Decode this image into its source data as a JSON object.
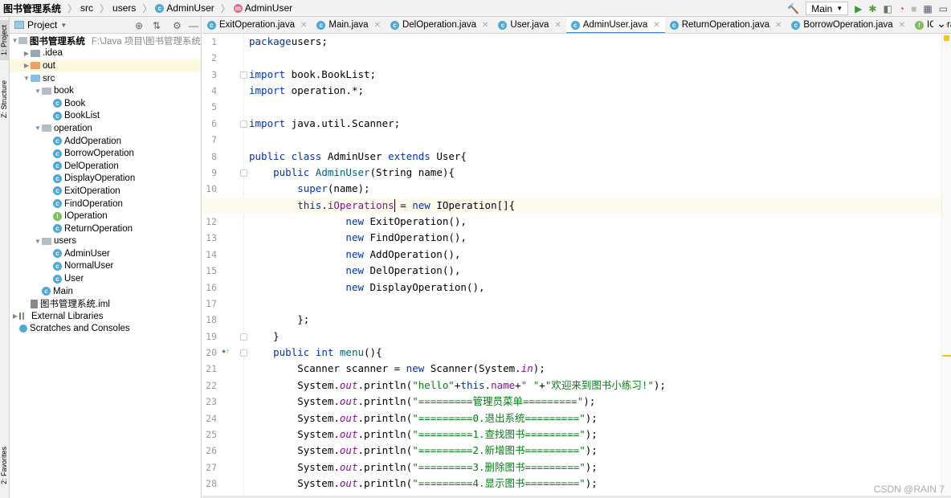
{
  "breadcrumb": [
    {
      "label": "图书管理系统",
      "icon": ""
    },
    {
      "label": "src",
      "icon": ""
    },
    {
      "label": "users",
      "icon": ""
    },
    {
      "label": "AdminUser",
      "icon": "class"
    },
    {
      "label": "AdminUser",
      "icon": "method"
    }
  ],
  "toolbar": {
    "run_config": "Main",
    "icons": [
      "hammer-icon",
      "run-icon",
      "debug-icon",
      "coverage-icon",
      "profile-icon",
      "stop-icon",
      "project-structure-icon",
      "terminal-icon"
    ]
  },
  "left_strip": {
    "project": "1: Project",
    "structure": "Z: Structure",
    "favorites": "2: Favorites"
  },
  "project_panel": {
    "title": "Project"
  },
  "tree": [
    {
      "label": "图书管理系统",
      "path": "F:\\Java  项目\\图书管理系统",
      "depth": 0,
      "arrow": "▼",
      "icon": "module",
      "bold": true
    },
    {
      "label": ".idea",
      "depth": 1,
      "arrow": "▶",
      "icon": "folder"
    },
    {
      "label": "out",
      "depth": 1,
      "arrow": "▶",
      "icon": "folder-orange",
      "selected": true
    },
    {
      "label": "src",
      "depth": 1,
      "arrow": "▼",
      "icon": "folder-blue"
    },
    {
      "label": "book",
      "depth": 2,
      "arrow": "▼",
      "icon": "package"
    },
    {
      "label": "Book",
      "depth": 3,
      "icon": "class"
    },
    {
      "label": "BookList",
      "depth": 3,
      "icon": "class"
    },
    {
      "label": "operation",
      "depth": 2,
      "arrow": "▼",
      "icon": "package"
    },
    {
      "label": "AddOperation",
      "depth": 3,
      "icon": "class"
    },
    {
      "label": "BorrowOperation",
      "depth": 3,
      "icon": "class"
    },
    {
      "label": "DelOperation",
      "depth": 3,
      "icon": "class"
    },
    {
      "label": "DisplayOperation",
      "depth": 3,
      "icon": "class"
    },
    {
      "label": "ExitOperation",
      "depth": 3,
      "icon": "class"
    },
    {
      "label": "FindOperation",
      "depth": 3,
      "icon": "class"
    },
    {
      "label": "IOperation",
      "depth": 3,
      "icon": "interface"
    },
    {
      "label": "ReturnOperation",
      "depth": 3,
      "icon": "class"
    },
    {
      "label": "users",
      "depth": 2,
      "arrow": "▼",
      "icon": "package"
    },
    {
      "label": "AdminUser",
      "depth": 3,
      "icon": "class"
    },
    {
      "label": "NormalUser",
      "depth": 3,
      "icon": "class"
    },
    {
      "label": "User",
      "depth": 3,
      "icon": "class"
    },
    {
      "label": "Main",
      "depth": 2,
      "icon": "class"
    },
    {
      "label": "图书管理系统.iml",
      "depth": 1,
      "icon": "file"
    },
    {
      "label": "External Libraries",
      "depth": 0,
      "arrow": "▶",
      "icon": "library"
    },
    {
      "label": "Scratches and Consoles",
      "depth": 0,
      "icon": "scratch"
    }
  ],
  "tabs": [
    {
      "label": "ExitOperation.java",
      "icon": "class"
    },
    {
      "label": "Main.java",
      "icon": "class"
    },
    {
      "label": "DelOperation.java",
      "icon": "class"
    },
    {
      "label": "User.java",
      "icon": "class"
    },
    {
      "label": "AdminUser.java",
      "icon": "class",
      "active": true
    },
    {
      "label": "ReturnOperation.java",
      "icon": "class"
    },
    {
      "label": "BorrowOperation.java",
      "icon": "class"
    },
    {
      "label": "IOperation.java",
      "icon": "interface"
    }
  ],
  "current_line": 11,
  "code": [
    [
      [
        "kw",
        "package"
      ],
      [
        "",
        "users;"
      ]
    ],
    [],
    [
      [
        "kw",
        "import"
      ],
      [
        "",
        " book.BookList;"
      ]
    ],
    [
      [
        "kw",
        "import"
      ],
      [
        "",
        " operation.*;"
      ]
    ],
    [],
    [
      [
        "kw",
        "import"
      ],
      [
        "",
        " java.util.Scanner;"
      ]
    ],
    [],
    [
      [
        "kw",
        "public class"
      ],
      [
        "",
        " AdminUser "
      ],
      [
        "kw",
        "extends"
      ],
      [
        "",
        " User{"
      ]
    ],
    [
      [
        "",
        "    "
      ],
      [
        "kw",
        "public"
      ],
      [
        "",
        " "
      ],
      [
        "mth",
        "AdminUser"
      ],
      [
        "",
        "(String name){"
      ]
    ],
    [
      [
        "",
        "        "
      ],
      [
        "kw",
        "super"
      ],
      [
        "",
        "(name);"
      ]
    ],
    [
      [
        "",
        "        "
      ],
      [
        "kw",
        "this"
      ],
      [
        "",
        "."
      ],
      [
        "fld",
        "iOperations"
      ],
      [
        "",
        " = "
      ],
      [
        "kw",
        "new"
      ],
      [
        "",
        " IOperation[]{"
      ]
    ],
    [
      [
        "",
        "                "
      ],
      [
        "kw",
        "new"
      ],
      [
        "",
        " ExitOperation(),"
      ]
    ],
    [
      [
        "",
        "                "
      ],
      [
        "kw",
        "new"
      ],
      [
        "",
        " FindOperation(),"
      ]
    ],
    [
      [
        "",
        "                "
      ],
      [
        "kw",
        "new"
      ],
      [
        "",
        " AddOperation(),"
      ]
    ],
    [
      [
        "",
        "                "
      ],
      [
        "kw",
        "new"
      ],
      [
        "",
        " DelOperation(),"
      ]
    ],
    [
      [
        "",
        "                "
      ],
      [
        "kw",
        "new"
      ],
      [
        "",
        " DisplayOperation(),"
      ]
    ],
    [],
    [
      [
        "",
        "        };"
      ]
    ],
    [
      [
        "",
        "    }"
      ]
    ],
    [
      [
        "",
        "    "
      ],
      [
        "kw",
        "public int"
      ],
      [
        "",
        " "
      ],
      [
        "mth",
        "menu"
      ],
      [
        "",
        "(){"
      ]
    ],
    [
      [
        "",
        "        Scanner scanner = "
      ],
      [
        "kw",
        "new"
      ],
      [
        "",
        " Scanner(System."
      ],
      [
        "st",
        "in"
      ],
      [
        "",
        ");"
      ]
    ],
    [
      [
        "",
        "        System."
      ],
      [
        "st",
        "out"
      ],
      [
        "",
        ".println("
      ],
      [
        "str",
        "\"hello\""
      ],
      [
        "",
        "+"
      ],
      [
        "kw",
        "this"
      ],
      [
        "",
        "."
      ],
      [
        "fld",
        "name"
      ],
      [
        "",
        "+"
      ],
      [
        "str",
        "\" \""
      ],
      [
        "",
        "+"
      ],
      [
        "str",
        "\"欢迎来到图书小练习!\""
      ],
      [
        "",
        ");"
      ]
    ],
    [
      [
        "",
        "        System."
      ],
      [
        "st",
        "out"
      ],
      [
        "",
        ".println("
      ],
      [
        "str",
        "\"=========管理员菜单=========\""
      ],
      [
        "",
        ");"
      ]
    ],
    [
      [
        "",
        "        System."
      ],
      [
        "st",
        "out"
      ],
      [
        "",
        ".println("
      ],
      [
        "str",
        "\"=========0.退出系统=========\""
      ],
      [
        "",
        ");"
      ]
    ],
    [
      [
        "",
        "        System."
      ],
      [
        "st",
        "out"
      ],
      [
        "",
        ".println("
      ],
      [
        "str",
        "\"=========1.查找图书=========\""
      ],
      [
        "",
        ");"
      ]
    ],
    [
      [
        "",
        "        System."
      ],
      [
        "st",
        "out"
      ],
      [
        "",
        ".println("
      ],
      [
        "str",
        "\"=========2.新增图书=========\""
      ],
      [
        "",
        ");"
      ]
    ],
    [
      [
        "",
        "        System."
      ],
      [
        "st",
        "out"
      ],
      [
        "",
        ".println("
      ],
      [
        "str",
        "\"=========3.删除图书=========\""
      ],
      [
        "",
        ");"
      ]
    ],
    [
      [
        "",
        "        System."
      ],
      [
        "st",
        "out"
      ],
      [
        "",
        ".println("
      ],
      [
        "str",
        "\"=========4.显示图书=========\""
      ],
      [
        "",
        ");"
      ]
    ]
  ],
  "watermark": "CSDN @RAIN 7"
}
